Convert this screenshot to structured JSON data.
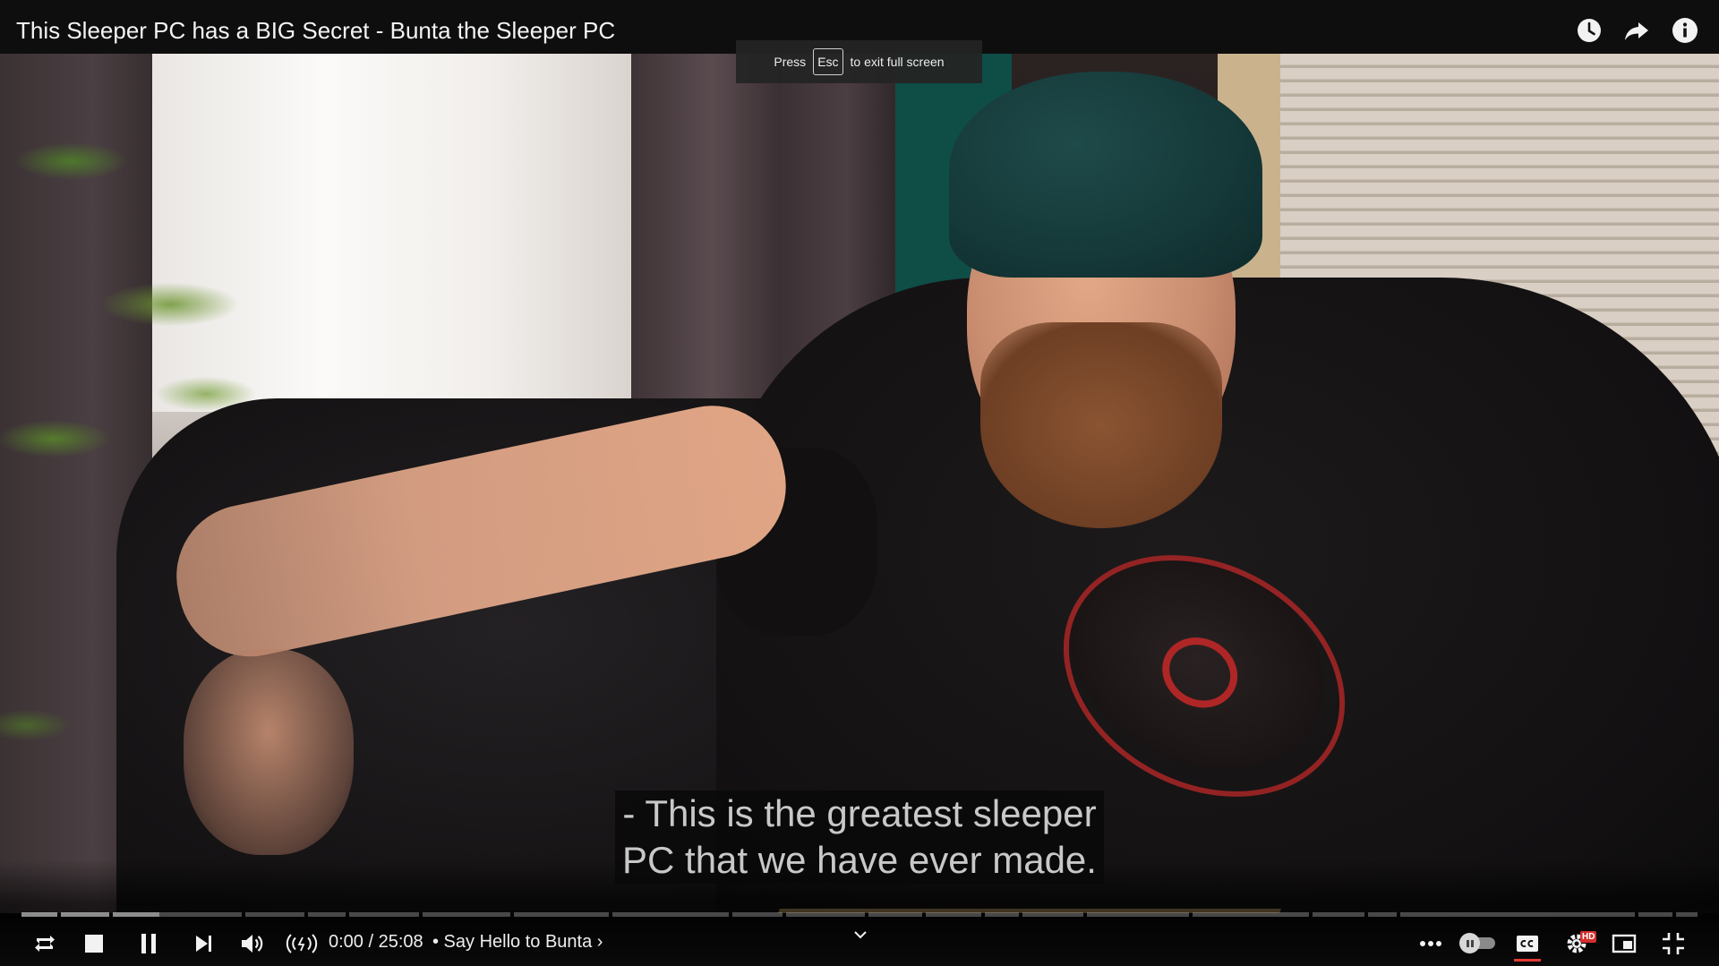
{
  "header": {
    "video_title": "This Sleeper PC has a BIG Secret - Bunta the Sleeper PC",
    "icons": [
      "watch-later-icon",
      "share-icon",
      "info-icon"
    ]
  },
  "fullscreen_hint": {
    "press": "Press",
    "key": "Esc",
    "suffix": "to exit full screen"
  },
  "captions": {
    "line1": "- This is the greatest sleeper",
    "line2": "PC that we have ever made."
  },
  "player": {
    "time_display": "0:00 / 25:08",
    "chapter_label": "• Say Hello to Bunta ›",
    "progress_fraction": 0.0,
    "controls": [
      "loop-icon",
      "stop-icon",
      "pause-icon",
      "next-icon",
      "volume-icon",
      "live-stream-icon",
      "more-options-icon",
      "autoplay-toggle",
      "captions-icon",
      "settings-icon",
      "miniplayer-icon",
      "exit-fullscreen-icon"
    ],
    "settings_badge": "HD",
    "accent_color": "#e53935"
  }
}
